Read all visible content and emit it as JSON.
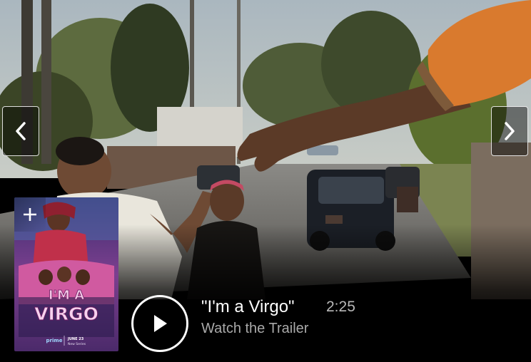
{
  "trailer": {
    "title": "\"I'm a Virgo\"",
    "duration": "2:25",
    "subtitle": "Watch the Trailer"
  },
  "poster": {
    "title_line1": "I'M A",
    "title_line2": "VIRGO",
    "brand": "prime",
    "date": "JUNE 23",
    "label": "New Series"
  },
  "icons": {
    "previous": "chevron-left-icon",
    "next": "chevron-right-icon",
    "add": "plus-icon",
    "play": "play-icon"
  },
  "colors": {
    "background": "#000000",
    "text": "#ffffff",
    "muted_text": "#a9a9a9"
  }
}
